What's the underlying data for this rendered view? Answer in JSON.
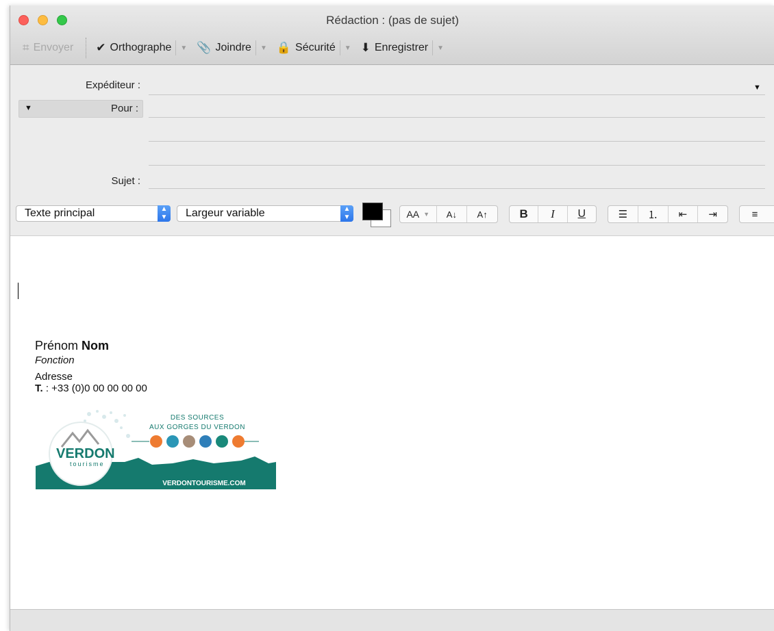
{
  "window": {
    "title": "Rédaction : (pas de sujet)"
  },
  "toolbar": {
    "send_label": "Envoyer",
    "spelling_label": "Orthographe",
    "attach_label": "Joindre",
    "security_label": "Sécurité",
    "save_label": "Enregistrer"
  },
  "headers": {
    "from_label": "Expéditeur :",
    "to_label": "Pour :",
    "subject_label": "Sujet :"
  },
  "format": {
    "style_value": "Texte principal",
    "font_value": "Largeur variable",
    "text_color": "#000000",
    "bg_color": "#ffffff",
    "font_size_label": "AA",
    "bold_label": "B",
    "italic_label": "I",
    "underline_label": "U"
  },
  "signature": {
    "first_name": "Prénom",
    "last_name": "Nom",
    "function": "Fonction",
    "address": "Adresse",
    "tel_label": "T.",
    "tel_value": " : +33 (0)0 00 00 00 00"
  },
  "logo": {
    "brand": "VERDON",
    "brand_sub": "tourisme",
    "tagline_1": "DES SOURCES",
    "tagline_2": "AUX GORGES DU VERDON",
    "website": "VERDONTOURISME.COM",
    "teal_color": "#157a6e",
    "icon_colors": [
      "#ee7b31",
      "#2a96b6",
      "#a78d78",
      "#2f7fb9",
      "#19897a",
      "#ee7b31"
    ]
  }
}
